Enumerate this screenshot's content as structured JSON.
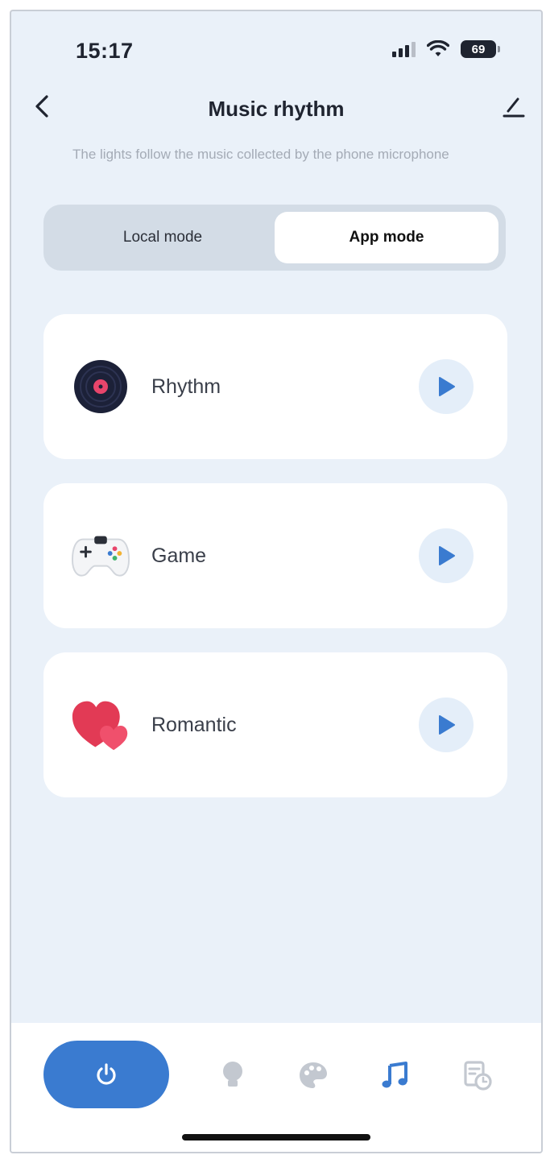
{
  "status_bar": {
    "time": "15:17",
    "battery": "69"
  },
  "header": {
    "title": "Music rhythm"
  },
  "subtitle": "The lights follow the music collected by the phone microphone",
  "mode_tabs": [
    {
      "label": "Local mode",
      "active": false
    },
    {
      "label": "App mode",
      "active": true
    }
  ],
  "scenes": [
    {
      "label": "Rhythm",
      "icon": "vinyl-record-icon"
    },
    {
      "label": "Game",
      "icon": "gamepad-icon"
    },
    {
      "label": "Romantic",
      "icon": "heart-icon"
    }
  ],
  "bottom_nav": {
    "items": [
      "power-icon",
      "bulb-icon",
      "palette-icon",
      "music-note-icon",
      "schedule-icon"
    ],
    "active": "music-note-icon"
  },
  "colors": {
    "accent": "#3a7bd0",
    "background": "#eaf1f9",
    "card": "#ffffff",
    "play_button_bg": "#e4eef9"
  }
}
